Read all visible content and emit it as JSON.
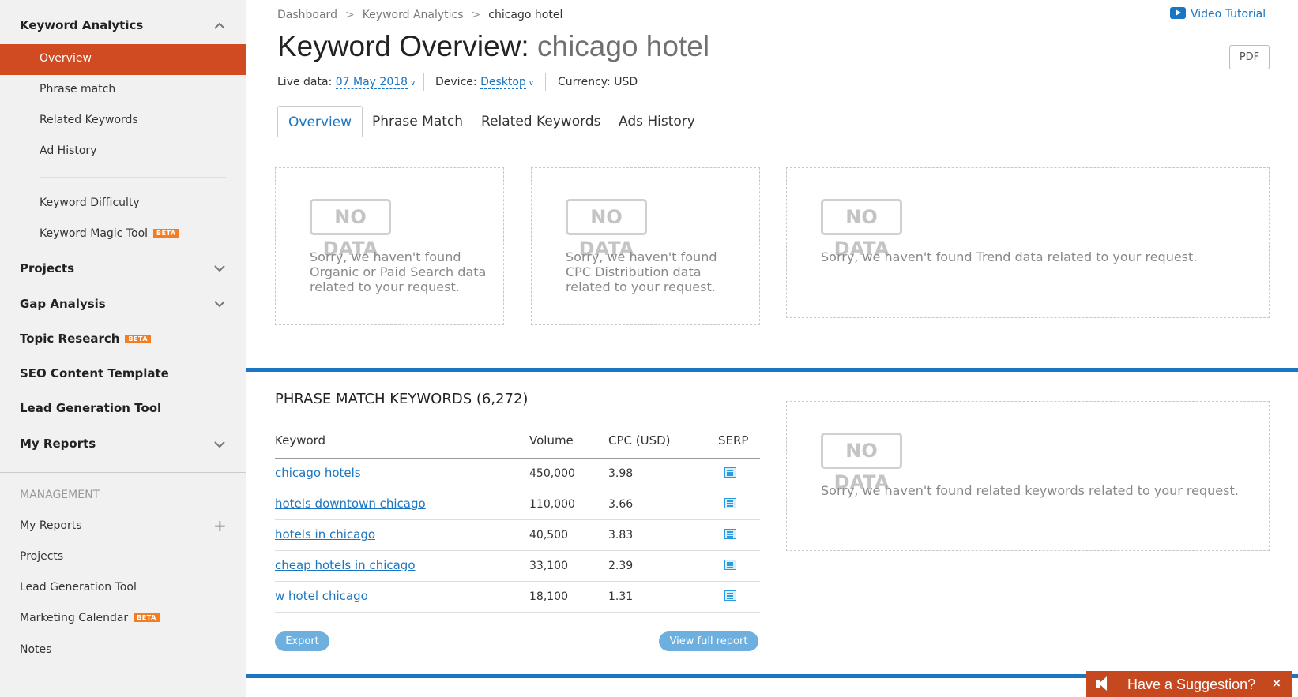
{
  "sidebar": {
    "keyword_analytics": "Keyword Analytics",
    "sub_items": [
      "Overview",
      "Phrase match",
      "Related Keywords",
      "Ad History",
      "Keyword Difficulty",
      "Keyword Magic Tool"
    ],
    "projects": "Projects",
    "gap_analysis": "Gap Analysis",
    "topic_research": "Topic Research",
    "seo_content_template": "SEO Content Template",
    "lead_generation_tool": "Lead Generation Tool",
    "my_reports": "My Reports",
    "beta_label": "BETA",
    "management_label": "MANAGEMENT",
    "management_items": [
      "My Reports",
      "Projects",
      "Lead Generation Tool",
      "Marketing Calendar",
      "Notes"
    ]
  },
  "breadcrumb": {
    "items": [
      "Dashboard",
      "Keyword Analytics",
      "chicago hotel"
    ],
    "separator": ">"
  },
  "video_tutorial": "Video Tutorial",
  "page_title": {
    "prefix": "Keyword Overview:",
    "keyword": "chicago hotel"
  },
  "pdf_button": "PDF",
  "meta": {
    "live_data_label": "Live data:",
    "live_data_value": "07 May 2018",
    "device_label": "Device:",
    "device_value": "Desktop",
    "currency": "Currency: USD"
  },
  "tabs": [
    "Overview",
    "Phrase Match",
    "Related Keywords",
    "Ads History"
  ],
  "no_data": {
    "badge": "NO DATA",
    "organic_paid": [
      "Sorry, we haven't found",
      "Organic or Paid Search data",
      "related to your request."
    ],
    "cpc": [
      "Sorry, we haven't found",
      "CPC Distribution data",
      "related to your request."
    ],
    "trend": "Sorry, we haven't found Trend data related to your request.",
    "related": "Sorry, we haven't found related keywords related to your request."
  },
  "phrase_match": {
    "title": "PHRASE MATCH KEYWORDS (6,272)",
    "columns": [
      "Keyword",
      "Volume",
      "CPC (USD)",
      "SERP"
    ],
    "rows": [
      {
        "keyword": "chicago hotels",
        "volume": "450,000",
        "cpc": "3.98"
      },
      {
        "keyword": "hotels downtown chicago",
        "volume": "110,000",
        "cpc": "3.66"
      },
      {
        "keyword": "hotels in chicago",
        "volume": "40,500",
        "cpc": "3.83"
      },
      {
        "keyword": "cheap hotels in chicago",
        "volume": "33,100",
        "cpc": "2.39"
      },
      {
        "keyword": "w hotel chicago",
        "volume": "18,100",
        "cpc": "1.31"
      }
    ],
    "export_button": "Export",
    "view_full_button": "View full report"
  },
  "suggestion": {
    "label": "Have a Suggestion?",
    "close": "×"
  },
  "colors": {
    "accent_orange": "#d04b22",
    "link_blue": "#1a76c3",
    "beta_orange": "#f57c20"
  },
  "icons": {
    "collapse": "chevron-up-icon",
    "expand": "chevron-down-icon",
    "add": "plus-icon",
    "video": "play-icon",
    "serp": "serp-page-icon",
    "megaphone": "megaphone-icon"
  }
}
